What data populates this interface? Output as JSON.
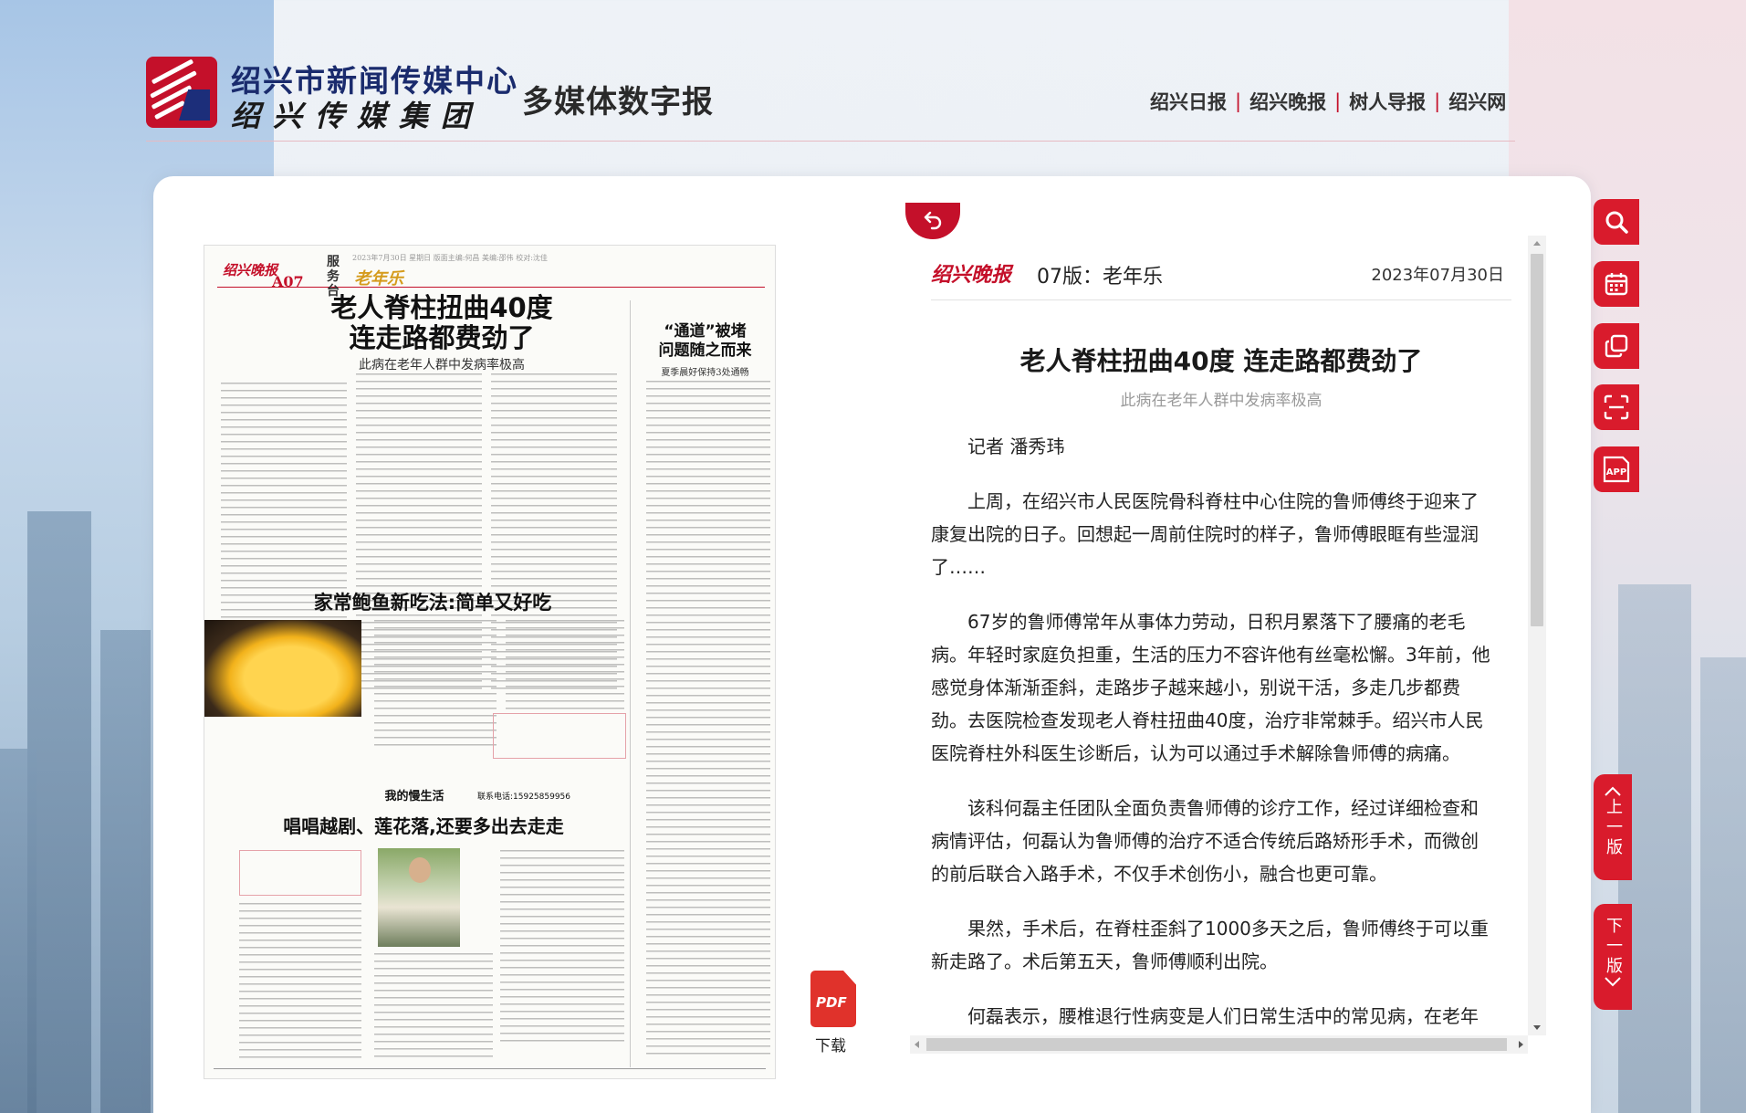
{
  "header": {
    "logo_line1": "绍兴市新闻传媒中心",
    "logo_line2": "绍兴传媒集团",
    "site_title": "多媒体数字报",
    "links": [
      "绍兴日报",
      "绍兴晚报",
      "树人导报",
      "绍兴网"
    ]
  },
  "newspaper": {
    "brand": "绍兴晚报",
    "page": "A07",
    "section": "服务台",
    "column": "老年乐",
    "info": "2023年7月30日 星期日  版面主编:何昌  美编:邵伟  校对:沈佳",
    "headline": "老人脊柱扭曲40度\n连走路都费劲了",
    "subhead": "此病在老年人群中发病率极高",
    "side_headline": "“通道”被堵\n问题随之而来",
    "side_sub": "夏季晨好保持3处通畅",
    "recipe_headline": "家常鲍鱼新吃法:简单又好吃",
    "life_column": "我的慢生活",
    "life_phone": "联系电话:15925859956",
    "life_headline": "唱唱越剧、莲花落,还要多出去走走"
  },
  "pdf": {
    "label": "下载",
    "icon_text": "PDF"
  },
  "article": {
    "brand": "绍兴晚报",
    "edition": "07版：老年乐",
    "date": "2023年07月30日",
    "title": "老人脊柱扭曲40度 连走路都费劲了",
    "subtitle": "此病在老年人群中发病率极高",
    "paragraphs": [
      "记者 潘秀玮",
      "上周，在绍兴市人民医院骨科脊柱中心住院的鲁师傅终于迎来了康复出院的日子。回想起一周前住院时的样子，鲁师傅眼眶有些湿润了……",
      "67岁的鲁师傅常年从事体力劳动，日积月累落下了腰痛的老毛病。年轻时家庭负担重，生活的压力不容许他有丝毫松懈。3年前，他感觉身体渐渐歪斜，走路步子越来越小，别说干活，多走几步都费劲。去医院检查发现老人脊柱扭曲40度，治疗非常棘手。绍兴市人民医院脊柱外科医生诊断后，认为可以通过手术解除鲁师傅的病痛。",
      "该科何磊主任团队全面负责鲁师傅的诊疗工作，经过详细检查和病情评估，何磊认为鲁师傅的治疗不适合传统后路矫形手术，而微创的前后联合入路手术，不仅手术创伤小，融合也更可靠。",
      "果然，手术后，在脊柱歪斜了1000多天之后，鲁师傅终于可以重新走路了。术后第五天，鲁师傅顺利出院。",
      "何磊表示，腰椎退行性病变是人们日常生活中的常见病，在老年"
    ]
  },
  "toolbar": {
    "tools": [
      "search-icon",
      "calendar-icon",
      "copy-icon",
      "scan-icon",
      "app-icon"
    ],
    "app_label": "APP",
    "prev_label": "上一版",
    "next_label": "下一版"
  },
  "colors": {
    "brand_red": "#c4102a",
    "tool_red": "#d91b2c",
    "navy": "#1a2b6d"
  }
}
